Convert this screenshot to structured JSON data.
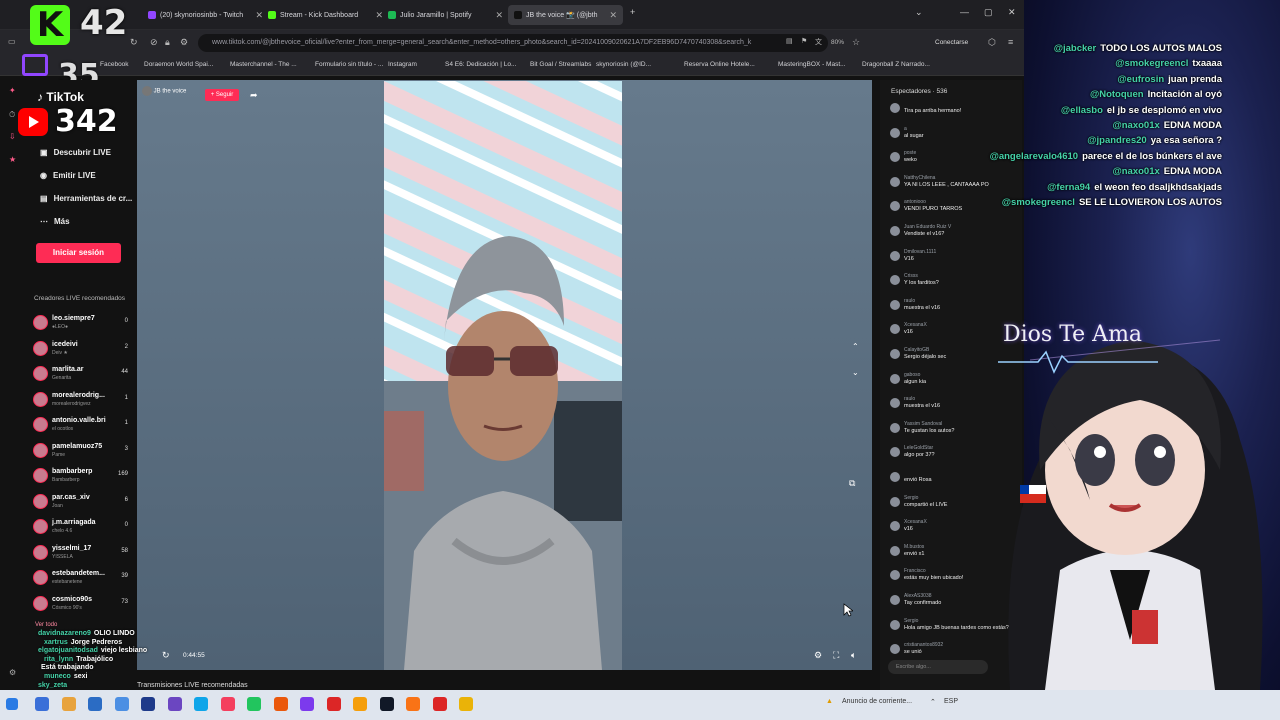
{
  "tabs": [
    {
      "label": "(20) skynoriosinbb - Twitch",
      "color": "#9146ff"
    },
    {
      "label": "Stream - Kick Dashboard",
      "color": "#53fc18"
    },
    {
      "label": "Julio Jaramillo | Spotify",
      "color": "#1db954"
    },
    {
      "label": "JB the voice 📸 (@jbth",
      "color": "#111111"
    }
  ],
  "address": {
    "url": "www.tiktok.com/@jbthevoice_oficial/live?enter_from_merge=general_search&enter_method=others_photo&search_id=20241009020621A7DF2EB96D7470740308&search_k",
    "zoom": "80%",
    "connect_label": "Conectarse"
  },
  "bookmarks": [
    "Facebook",
    "Doraemon World Spai...",
    "Masterchannel - The ...",
    "Formulario sin título - ...",
    "Instagram",
    "S4 E6: Dedicación | Lo...",
    "Bit Goal / Streamlabs",
    "skynoriosin (@ID...",
    "Reserva Online Hotele...",
    "MasteringBOX - Mast...",
    "Dragonball Z Narrado..."
  ],
  "overlay_counters": {
    "kick_count": "42",
    "top_count": "35",
    "youtube_count": "342",
    "kick_letter": "K"
  },
  "tiktok_nav": {
    "logo": "TikTok",
    "items": [
      "Descubrir LIVE",
      "Emitir LIVE",
      "Herramientas de cr...",
      "Más"
    ],
    "login_label": "Iniciar sesión",
    "section_title": "Creadores LIVE recomendados",
    "creators": [
      {
        "name": "leo.siempre7",
        "sub": "●LEO●",
        "count": "0"
      },
      {
        "name": "icedeivi",
        "sub": "Deiv ★",
        "count": "2"
      },
      {
        "name": "marlita.ar",
        "sub": "Genarita",
        "count": "44"
      },
      {
        "name": "morealerodrig...",
        "sub": "morealerodrigvez",
        "count": "1"
      },
      {
        "name": "antonio.valle.bri",
        "sub": "el ocotlos",
        "count": "1"
      },
      {
        "name": "pamelamuoz75",
        "sub": "Pame",
        "count": "3"
      },
      {
        "name": "bambarberp",
        "sub": "Bambarberp",
        "count": "169"
      },
      {
        "name": "par.cas_xiv",
        "sub": "Joan",
        "count": "6"
      },
      {
        "name": "j.m.arriagada",
        "sub": "chelo 4.6",
        "count": "0"
      },
      {
        "name": "yisselmi_17",
        "sub": "YISSELA",
        "count": "58"
      },
      {
        "name": "estebandetem...",
        "sub": "estebanetene",
        "count": "39"
      },
      {
        "name": "cosmico90s",
        "sub": "Cósmico 90's",
        "count": "73"
      }
    ],
    "see_all": "Ver todo"
  },
  "stream": {
    "host_name": "JB the voice",
    "follow_label": "+ Seguir",
    "time": "0:44:55",
    "recommended_label": "Transmisiones LIVE recomendadas"
  },
  "live_chat": {
    "header": "Espectadores · 536",
    "input_placeholder": "Escribe algo...",
    "messages": [
      {
        "user": "",
        "text": "Tira pa arriba hermano!"
      },
      {
        "user": "a",
        "text": "al sugar"
      },
      {
        "user": "poste",
        "text": "weko"
      },
      {
        "user": "NatthyChilena",
        "text": "YA NI LOS LEEE , CANTAAAA PO"
      },
      {
        "user": "antoniooo",
        "text": "VENDI PURO TARROS"
      },
      {
        "user": "Juan Eduardo Ruiz V",
        "text": "Vendiste el v16?"
      },
      {
        "user": "Dmilovan.1111",
        "text": "V16"
      },
      {
        "user": "Crisss",
        "text": "Y los farditos?"
      },
      {
        "user": "raulo",
        "text": "muestra el v16"
      },
      {
        "user": "XcesanaX",
        "text": "v16"
      },
      {
        "user": "CalayitoGB",
        "text": "Sergio déjalo sec"
      },
      {
        "user": "gaboso",
        "text": "algun kia"
      },
      {
        "user": "raulo",
        "text": "muestra el v16"
      },
      {
        "user": "Yassim Sandoval",
        "text": "Te gustan los autos?"
      },
      {
        "user": "LeleGoldStar",
        "text": "algo por 37?"
      },
      {
        "user": "",
        "text": "envió Rosa"
      },
      {
        "user": "Sergio",
        "text": "compartió el LIVE"
      },
      {
        "user": "XcesanaX",
        "text": "v16"
      },
      {
        "user": "M.bustos",
        "text": "envió x1"
      },
      {
        "user": "Francisco",
        "text": "estás muy bien ubicado!"
      },
      {
        "user": "AlexAS3038",
        "text": "Tay confirmado"
      },
      {
        "user": "Sergio",
        "text": "Hola amigo JB buenas tardes como estás?"
      },
      {
        "user": "cristianantos8932",
        "text": "se unió"
      }
    ]
  },
  "overlay_chat": [
    {
      "user": "@jabcker",
      "text": "TODO LOS AUTOS MALOS"
    },
    {
      "user": "@smokegreencl",
      "text": "txaaaa"
    },
    {
      "user": "@eufrosin",
      "text": "juan prenda"
    },
    {
      "user": "@Notoquen",
      "text": "Incitación al oyó"
    },
    {
      "user": "@ellasbo",
      "text": "el jb se desplomó en vivo"
    },
    {
      "user": "@naxo01x",
      "text": "EDNA MODA"
    },
    {
      "user": "@jpandres20",
      "text": "ya esa señora ?"
    },
    {
      "user": "@angelarevalo4610",
      "text": "parece el de los búnkers el ave"
    },
    {
      "user": "@naxo01x",
      "text": "EDNA MODA"
    },
    {
      "user": "@ferna94",
      "text": "el weon feo dsaljkhdsakjads"
    },
    {
      "user": "@smokegreencl",
      "text": "SE LE LLOVIERON LOS AUTOS"
    }
  ],
  "bottom_chat": [
    {
      "user": "davidnazareno9",
      "text": "OLIO LINDO"
    },
    {
      "user": "xartrus",
      "text": "Jorge Pedreros"
    },
    {
      "user": "elgatojuanitodsad",
      "text": "viejo lesbiano"
    },
    {
      "user": "rita_lynn",
      "text": "Trabajólico"
    },
    {
      "user": "",
      "text": "Está trabajando"
    },
    {
      "user": "muneco",
      "text": "sexi"
    },
    {
      "user": "sky_zeta",
      "text": ""
    }
  ],
  "vtuber": {
    "banner": "Dios Te Ama"
  },
  "taskbar": {
    "notification": "Anuncio de corriente...",
    "lang": "ESP"
  },
  "colors": {
    "tiktok_red": "#fe2c55",
    "kick_green": "#53fc18",
    "chat_user": "#45d2a8"
  }
}
